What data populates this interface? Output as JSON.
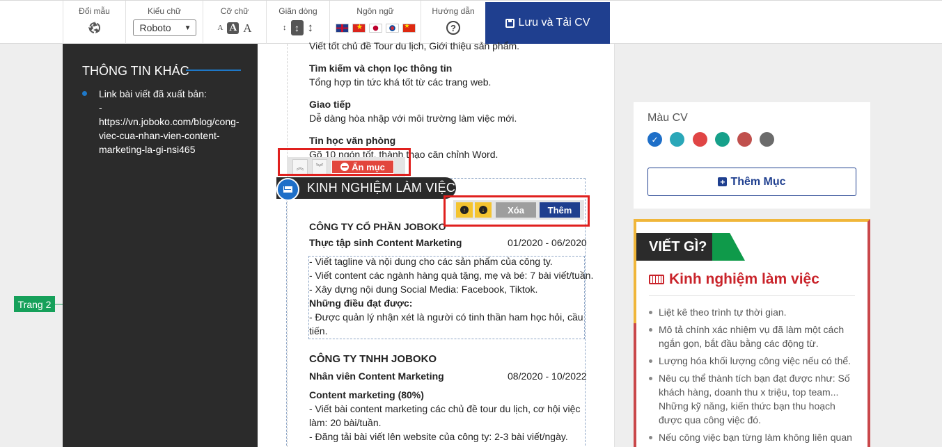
{
  "toolbar": {
    "color_label": "Đổi mẫu",
    "font_label": "Kiểu chữ",
    "font_value": "Roboto",
    "size_label": "Cỡ chữ",
    "size_glyph": "A",
    "spacing_label": "Giãn dòng",
    "language_label": "Ngôn ngữ",
    "guide_label": "Hướng dẫn",
    "save_label": "Lưu và Tải CV"
  },
  "sidebar": {
    "title": "THÔNG TIN KHÁC",
    "link_text": "Link bài viết đã xuất bản:\n-\nhttps://vn.joboko.com/blog/cong-viec-cua-nhan-vien-content-marketing-la-gi-nsi465"
  },
  "page_badge": "Trang 2",
  "cv": {
    "top_line": "Viết tốt chủ đề Tour du lịch, Giới thiệu sản phẩm.",
    "skills": [
      {
        "name": "Tìm kiếm và chọn lọc thông tin",
        "desc": "Tổng hợp tin tức khá tốt từ các trang web."
      },
      {
        "name": "Giao tiếp",
        "desc": "Dễ dàng hòa nhập với môi trường làm việc mới."
      },
      {
        "name": "Tin học văn phòng",
        "desc": "Gõ 10 ngón tốt, thành thạo căn chỉnh Word."
      }
    ],
    "section_title": "KINH NGHIỆM LÀM VIỆC",
    "hide_label": "Ẩn mục",
    "delete_label": "Xóa",
    "add_label": "Thêm",
    "jobs": [
      {
        "company": "CÔNG TY CỔ PHẦN JOBOKO",
        "role": "Thực tập sinh Content Marketing",
        "period": "01/2020 - 06/2020",
        "lines": [
          "- Viết tagline và nội dung cho các sản phẩm của công ty.",
          "- Viết content các ngành hàng quà tặng, mẹ và bé: 7 bài viết/tuần.",
          "- Xây dựng nội dung Social Media: Facebook, Tiktok."
        ],
        "achievement_title": "Những điều đạt được:",
        "achievement_line1": "- Được quản lý nhận xét là người có tinh thần ham học hỏi, cầu",
        "achievement_line2": "tiến."
      },
      {
        "company": "CÔNG TY TNHH JOBOKO",
        "role": "Nhân viên Content Marketing",
        "period": "08/2020 - 10/2022",
        "sub_title": "Content marketing (80%)",
        "lines": [
          "- Viết bài content marketing các chủ đề tour du lịch, cơ hội việc",
          "làm: 20 bài/tuần.",
          "- Đăng tải bài viết lên website của công ty: 2-3 bài viết/ngày."
        ]
      }
    ]
  },
  "right": {
    "color_label": "Màu CV",
    "colors": [
      "#1e6fc8",
      "#2aa7b8",
      "#e04545",
      "#16a08a",
      "#c0504d",
      "#6b6b6b"
    ],
    "add_section_label": "Thêm Mục",
    "tips_head": "VIẾT GÌ?",
    "tips_title": "Kinh nghiệm làm việc",
    "tips": [
      "Liệt kê theo trình tự thời gian.",
      "Mô tả chính xác nhiệm vụ đã làm một cách ngắn gọn, bắt đầu bằng các động từ.",
      "Lượng hóa khối lượng công việc nếu có thể.",
      "Nêu cụ thể thành tích bạn đạt được như: Số khách hàng, doanh thu x triệu, top team... Những kỹ năng, kiến thức bạn thu hoạch được qua công việc đó.",
      "Nếu công việc bạn từng làm không liên quan"
    ]
  }
}
